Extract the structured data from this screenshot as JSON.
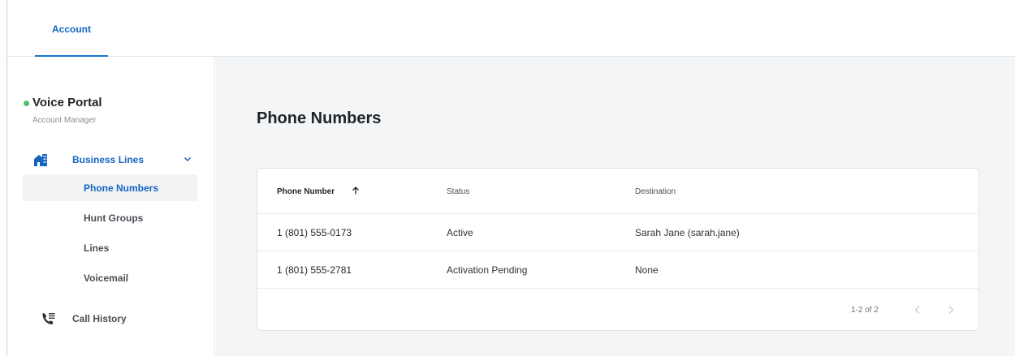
{
  "top_tabs": [
    {
      "label": "Account",
      "active": true
    }
  ],
  "sidebar": {
    "portal": {
      "title": "Voice Portal",
      "subtitle": "Account Manager",
      "status_color": "#55c26a"
    },
    "group": {
      "label": "Business Lines",
      "icon": "building-icon",
      "expanded": true,
      "items": [
        {
          "label": "Phone Numbers",
          "active": true
        },
        {
          "label": "Hunt Groups",
          "active": false
        },
        {
          "label": "Lines",
          "active": false
        },
        {
          "label": "Voicemail",
          "active": false
        }
      ]
    },
    "history": {
      "label": "Call History",
      "icon": "phone-list-icon"
    }
  },
  "main": {
    "title": "Phone Numbers",
    "table": {
      "columns": [
        {
          "label": "Phone Number",
          "sorted": "ascending"
        },
        {
          "label": "Status"
        },
        {
          "label": "Destination"
        }
      ],
      "rows": [
        {
          "phone_number": "1 (801) 555-0173",
          "status": "Active",
          "destination": "Sarah Jane (sarah.jane)"
        },
        {
          "phone_number": "1 (801) 555-2781",
          "status": "Activation Pending",
          "destination": "None"
        }
      ],
      "pagination": {
        "range_text": "1-2 of 2",
        "prev_icon": "chevron-left-icon",
        "next_icon": "chevron-right-icon"
      }
    }
  },
  "colors": {
    "accent": "#1565c0",
    "accent_underline": "#1976d2",
    "main_background": "#f3f5f7",
    "active_item_background": "#f1f3f5"
  }
}
